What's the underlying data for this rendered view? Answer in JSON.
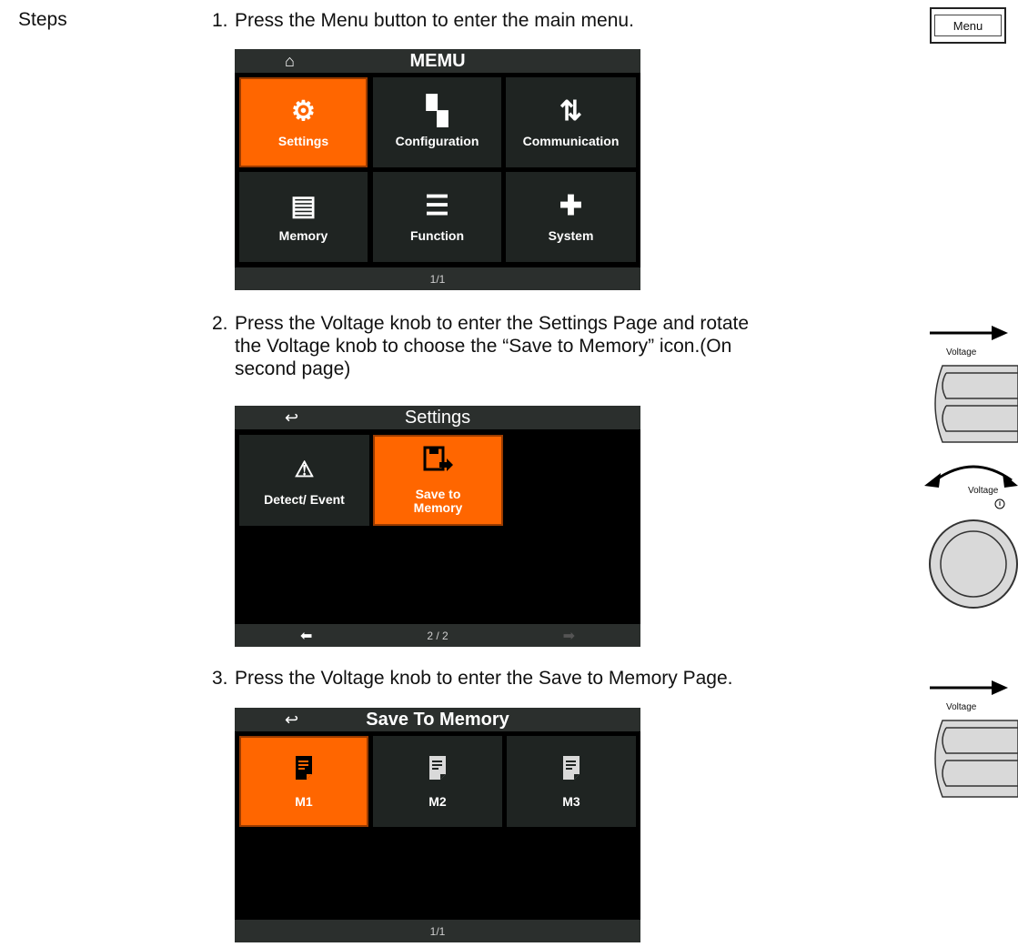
{
  "steps_label": "Steps",
  "step1": {
    "num": "1.",
    "text": "Press the Menu button to enter the main menu."
  },
  "menu_screen": {
    "title": "MEMU",
    "home_icon": "home-icon",
    "tiles": [
      {
        "label": "Settings",
        "icon": "gear-icon",
        "glyph": "⚙",
        "selected": true
      },
      {
        "label": "Configuration",
        "icon": "configuration-icon",
        "glyph": "▚",
        "selected": false
      },
      {
        "label": "Communication",
        "icon": "communication-icon",
        "glyph": "⇅",
        "selected": false
      },
      {
        "label": "Memory",
        "icon": "memory-icon",
        "glyph": "▤",
        "selected": false
      },
      {
        "label": "Function",
        "icon": "list-icon",
        "glyph": "☰",
        "selected": false
      },
      {
        "label": "System",
        "icon": "puzzle-icon",
        "glyph": "✚",
        "selected": false
      }
    ],
    "page": "1/1"
  },
  "step2": {
    "num": "2.",
    "line1": "Press the Voltage knob to enter the Settings Page and rotate",
    "line2": "the Voltage knob to choose the “Save to Memory” icon.(On",
    "line3": "second page)"
  },
  "settings_screen": {
    "title": "Settings",
    "tiles": [
      {
        "label": "Detect/ Event",
        "icon": "warning-icon",
        "glyph": "⚠",
        "selected": false
      },
      {
        "label": "Save to\nMemory",
        "icon": "save-to-memory-icon",
        "glyph": "💾",
        "selected": true
      }
    ],
    "page": "2 / 2"
  },
  "step3": {
    "num": "3.",
    "text": "Press the Voltage knob to enter the Save to Memory Page."
  },
  "save_screen": {
    "title": "Save To Memory",
    "tiles": [
      {
        "label": "M1",
        "icon": "file-icon",
        "selected": true
      },
      {
        "label": "M2",
        "icon": "file-icon",
        "selected": false
      },
      {
        "label": "M3",
        "icon": "file-icon",
        "selected": false
      }
    ],
    "page": "1/1"
  },
  "panel": {
    "menu_button_label": "Menu",
    "voltage_label_1": "Voltage",
    "voltage_label_2": "Voltage",
    "voltage_label_3": "Voltage"
  },
  "colors": {
    "selected": "#ff6600",
    "tile": "#1f2422",
    "bar": "#2b2f2d"
  }
}
